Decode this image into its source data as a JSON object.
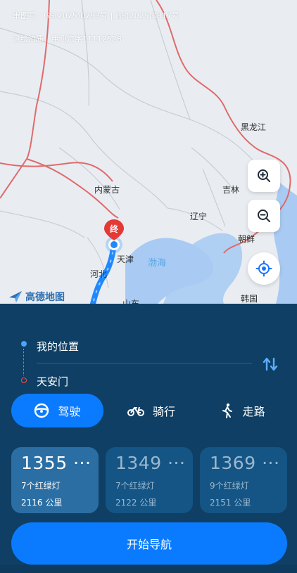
{
  "map": {
    "approval": "审图号：GS(2025)0293号 | GS(2025)0817号",
    "survey": "测绘资质：甲测资字11112528",
    "labels": {
      "heilongjiang": "黑龙江",
      "neimenggu": "内蒙古",
      "jilin": "吉林",
      "liaoning": "辽宁",
      "chaoxian": "朝鲜",
      "tianjin": "天津",
      "hebei": "河北",
      "bohai": "渤海",
      "shandong": "山东",
      "hanguo": "韩国",
      "end_marker": "终"
    },
    "logo": "高德地图",
    "buttons": {
      "zoom_in": "zoom-in-icon",
      "zoom_out": "zoom-out-icon",
      "locate": "locate-icon"
    }
  },
  "route": {
    "from": "我的位置",
    "to": "天安门"
  },
  "modes": [
    {
      "label": "驾驶",
      "icon": "steering-wheel-icon",
      "active": true
    },
    {
      "label": "骑行",
      "icon": "bicycle-icon",
      "active": false
    },
    {
      "label": "走路",
      "icon": "walking-icon",
      "active": false
    }
  ],
  "options": [
    {
      "time": "1355 ···",
      "lights": "7个红绿灯",
      "distance": "2116 公里",
      "active": true
    },
    {
      "time": "1349 ···",
      "lights": "7个红绿灯",
      "distance": "2122 公里",
      "active": false
    },
    {
      "time": "1369 ···",
      "lights": "9个红绿灯",
      "distance": "2151 公里",
      "active": false
    }
  ],
  "start_button": "开始导航",
  "colors": {
    "panel": "#0f3f64",
    "accent": "#0a7bff",
    "route": "#1e88ff",
    "end_marker": "#e53935"
  }
}
